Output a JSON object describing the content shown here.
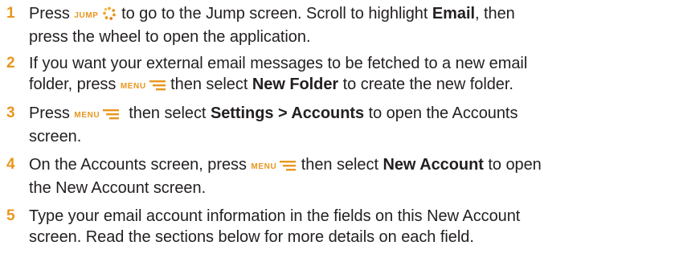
{
  "steps": [
    {
      "number": "1",
      "line1": {
        "pre": "Press ",
        "key_label": "JUMP",
        "key_icon": "jump-dots-icon",
        "mid": " to go to the Jump screen. Scroll to highlight ",
        "bold": "Email",
        "post": ", then"
      },
      "line2": {
        "text": "press the wheel to open the application."
      }
    },
    {
      "number": "2",
      "line1": {
        "text": "If you want your external email messages to be fetched to a new email"
      },
      "line2": {
        "pre": "folder, press ",
        "key_label": "MENU",
        "key_icon": "menu-lines-icon",
        "mid": " then select ",
        "bold": "New Folder",
        "post": " to create the new folder."
      }
    },
    {
      "number": "3",
      "line1": {
        "pre": "Press ",
        "key_label": "MENU",
        "key_icon": "menu-lines-icon",
        "mid": "  then select ",
        "bold1": "Settings",
        "sep": " > ",
        "bold2": "Accounts",
        "post": " to open the Accounts"
      },
      "line2": {
        "text": "screen."
      }
    },
    {
      "number": "4",
      "line1": {
        "pre": "On the Accounts screen, press ",
        "key_label": "MENU",
        "key_icon": "menu-lines-icon",
        "mid": " then select ",
        "bold": "New Account",
        "post": " to open"
      },
      "line2": {
        "text": "the New Account screen."
      }
    },
    {
      "number": "5",
      "line1": {
        "text": "Type your email account information in the fields on this New Account"
      },
      "line2": {
        "text": "screen. Read the sections below for more details on each field."
      }
    }
  ],
  "colors": {
    "accent": "#e8961e",
    "text": "#231f20"
  }
}
